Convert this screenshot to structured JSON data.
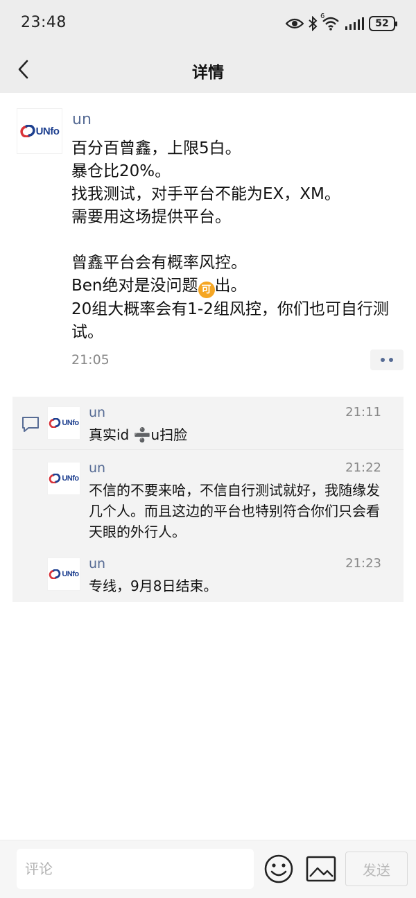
{
  "status_bar": {
    "time": "23:48",
    "signal_label": "6",
    "battery": "52",
    "icons": [
      "eye-icon",
      "bluetooth-icon",
      "wifi-icon",
      "signal-icon",
      "battery-icon"
    ]
  },
  "nav": {
    "title": "详情",
    "back_icon": "chevron-left-icon"
  },
  "post": {
    "author": "un",
    "avatar_logo_text": "UNfo",
    "lines": [
      "百分百曾鑫，上限5白。",
      "暴仓比20%。",
      "找我测试，对手平台不能为EX，XM。",
      "需要用这场提供平台。",
      "",
      "曾鑫平台会有概率风控。",
      "Ben绝对是没问题",
      "20组大概率会有1-2组风控，你们也可自行测试。"
    ],
    "emoji_glyph": "可",
    "emoji_suffix": "出。",
    "time": "21:05",
    "more_icon": "more-dots-icon"
  },
  "comments": [
    {
      "author": "un",
      "time": "21:11",
      "text": "真实id ➗u扫脸"
    },
    {
      "author": "un",
      "time": "21:22",
      "text": "不信的不要来哈，不信自行测试就好，我随缘发几个人。而且这边的平台也特别符合你们只会看天眼的外行人。"
    },
    {
      "author": "un",
      "time": "21:23",
      "text": "专线，9月8日结束。"
    }
  ],
  "bottom_bar": {
    "input_placeholder": "评论",
    "input_value": "",
    "send_label": "发送"
  },
  "colors": {
    "bar_bg": "#ededed",
    "author_blue": "#566b94",
    "logo_red": "#d9343a",
    "logo_blue": "#1d3f8f"
  }
}
